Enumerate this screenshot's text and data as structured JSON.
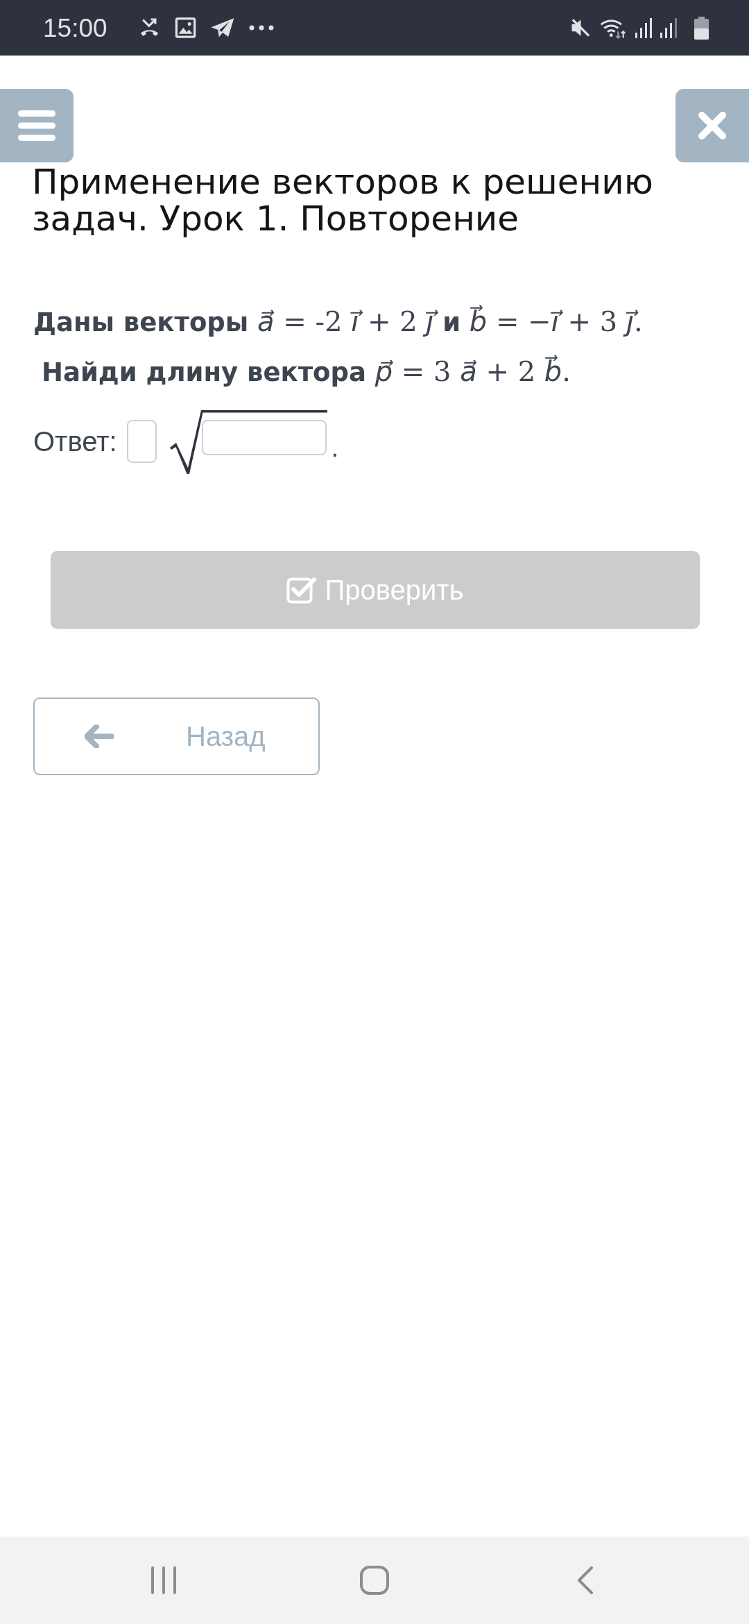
{
  "status_bar": {
    "time": "15:00"
  },
  "title": "Применение векторов к решению задач. Урок 1. Повторение",
  "problem": {
    "lines": [
      "**Даны векторы** *a⃗* = -2 *i⃗* + 2 *j⃗* **и** *b⃗* = −*i⃗* + 3 *j⃗*.",
      "**Найди длину вектора** *p⃗* = 3 *a⃗* + 2 *b⃗*."
    ]
  },
  "answer": {
    "label": "Ответ:",
    "end": "."
  },
  "check_button": {
    "label": "Проверить",
    "disabled": true
  },
  "back_button": {
    "label": "Назад"
  }
}
